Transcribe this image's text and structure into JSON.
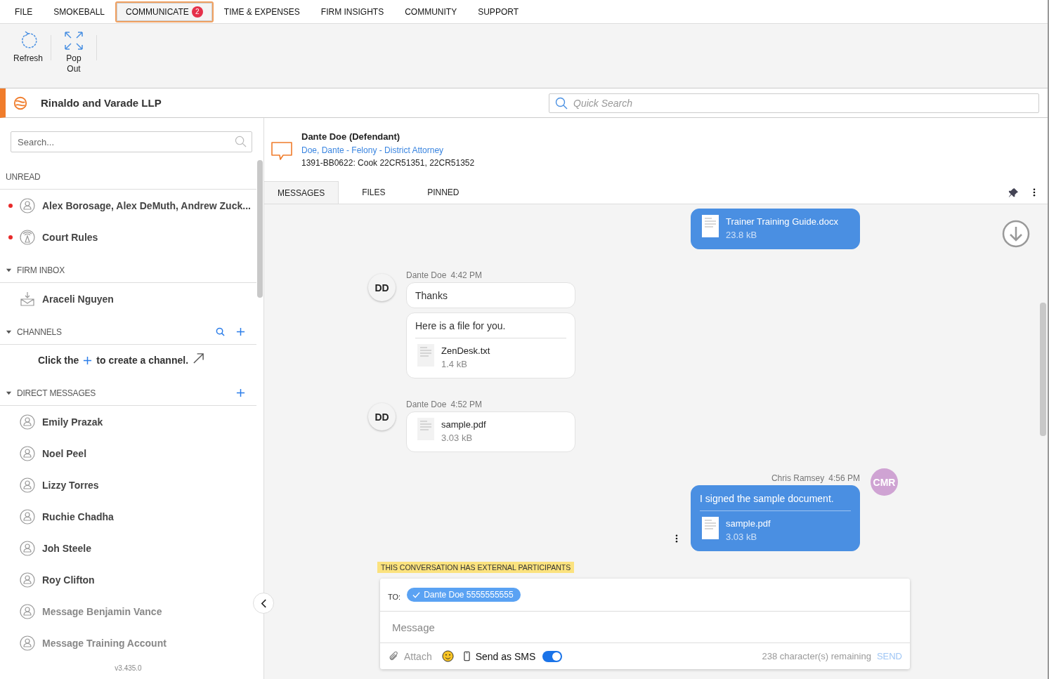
{
  "menu": [
    {
      "label": "FILE",
      "selected": false
    },
    {
      "label": "SMOKEBALL",
      "selected": false
    },
    {
      "label": "COMMUNICATE",
      "selected": true,
      "badge": "2"
    },
    {
      "label": "TIME & EXPENSES",
      "selected": false
    },
    {
      "label": "FIRM INSIGHTS",
      "selected": false
    },
    {
      "label": "COMMUNITY",
      "selected": false
    },
    {
      "label": "SUPPORT",
      "selected": false
    }
  ],
  "ribbon": [
    {
      "label": "Refresh",
      "kind": "refresh"
    },
    {
      "label": "Pop Out",
      "kind": "popout"
    }
  ],
  "firm": {
    "name": "Rinaldo and Varade LLP"
  },
  "quick_search": {
    "placeholder": "Quick Search"
  },
  "sidebar": {
    "search": {
      "placeholder": "Search..."
    },
    "unread": {
      "title": "UNREAD",
      "items": [
        {
          "name": "Alex Borosage, Alex DeMuth, Andrew Zuck...",
          "kind": "person",
          "unread": true
        },
        {
          "name": "Court Rules",
          "kind": "channel",
          "unread": true
        }
      ]
    },
    "firm_inbox": {
      "title": "FIRM INBOX",
      "expanded": true,
      "items": [
        {
          "name": "Araceli Nguyen"
        }
      ]
    },
    "channels": {
      "title": "CHANNELS",
      "expanded": true,
      "hint_before": "Click the",
      "hint_after": "to create a channel."
    },
    "direct_messages": {
      "title": "DIRECT MESSAGES",
      "expanded": true,
      "items": [
        {
          "name": "Emily Prazak",
          "muted": false
        },
        {
          "name": "Noel Peel",
          "muted": false
        },
        {
          "name": "Lizzy Torres",
          "muted": false
        },
        {
          "name": "Ruchie Chadha",
          "muted": false
        },
        {
          "name": "Joh Steele",
          "muted": false
        },
        {
          "name": "Roy Clifton",
          "muted": false
        },
        {
          "name": "Message Benjamin Vance",
          "muted": true
        },
        {
          "name": "Message Training Account",
          "muted": true
        }
      ]
    },
    "version": "v3.435.0"
  },
  "conversation": {
    "title": "Dante Doe (Defendant)",
    "subtitle": "Doe, Dante - Felony - District Attorney",
    "matter": "1391-BB0622: Cook 22CR51351, 22CR51352",
    "tabs": [
      {
        "label": "MESSAGES",
        "selected": true
      },
      {
        "label": "FILES",
        "selected": false
      },
      {
        "label": "PINNED",
        "selected": false
      }
    ]
  },
  "messages": [
    {
      "kind": "outgoing",
      "blocks": [
        {
          "file": "Trainer Training Guide.docx",
          "size": "23.8 kB"
        }
      ]
    },
    {
      "kind": "incoming",
      "initials": "DD",
      "sender": "Dante Doe",
      "time": "4:42 PM",
      "blocks": [
        {
          "text": "Thanks"
        }
      ]
    },
    {
      "kind": "incoming",
      "blocks": [
        {
          "text": "Here is a file for you."
        },
        {
          "file": "ZenDesk.txt",
          "size": "1.4 kB"
        }
      ]
    },
    {
      "kind": "incoming",
      "initials": "DD",
      "sender": "Dante Doe",
      "time": "4:52 PM",
      "blocks": [
        {
          "file": "sample.pdf",
          "size": "3.03 kB"
        }
      ]
    },
    {
      "kind": "outgoing",
      "initials": "CMR",
      "sender": "Chris Ramsey",
      "time": "4:56 PM",
      "color": "#cfa3d3",
      "blocks": [
        {
          "text": "I signed the sample document."
        },
        {
          "file": "sample.pdf",
          "size": "3.03 kB"
        }
      ]
    }
  ],
  "composer": {
    "notice": "THIS CONVERSATION HAS EXTERNAL PARTICIPANTS",
    "to_label": "TO:",
    "recipient": "Dante Doe 5555555555",
    "placeholder": "Message",
    "attach": "Attach",
    "sms_label": "Send as SMS",
    "sms_on": true,
    "remaining": "238 character(s) remaining",
    "send": "SEND"
  }
}
